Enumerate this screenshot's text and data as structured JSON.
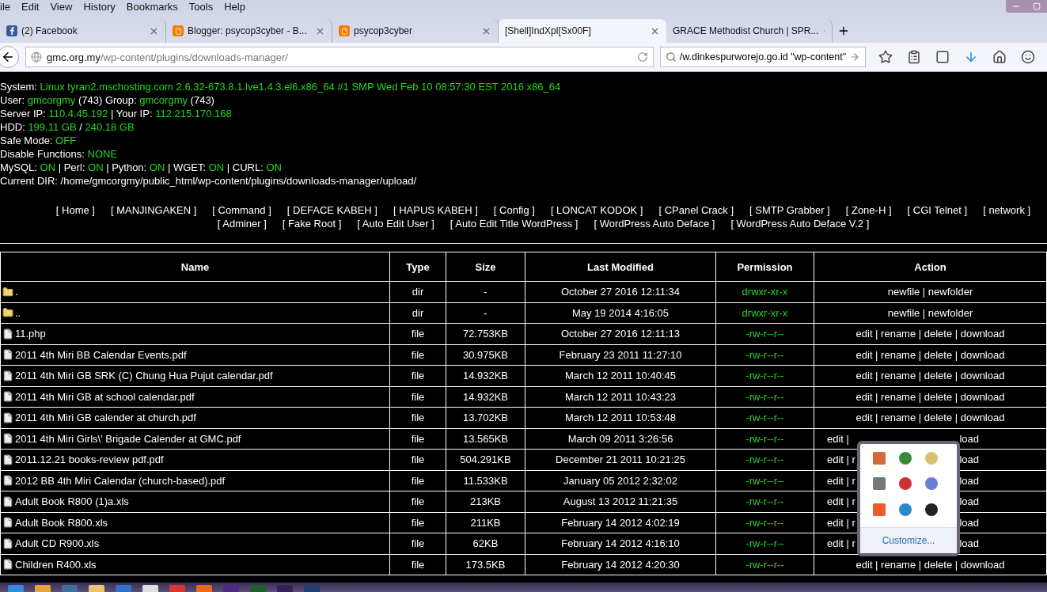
{
  "menu": [
    "ile",
    "Edit",
    "View",
    "History",
    "Bookmarks",
    "Tools",
    "Help"
  ],
  "tabs": [
    {
      "title": "(2) Facebook",
      "selected": false
    },
    {
      "title": "Blogger: psycop3cyber - B...",
      "selected": false
    },
    {
      "title": "psycop3cyber",
      "selected": false
    },
    {
      "title": "[Shell]IndXpl[Sx00F]",
      "selected": true
    },
    {
      "title": "GRACE Methodist Church | SPR...",
      "selected": false
    }
  ],
  "address": {
    "host": "gmc.org.my",
    "path": "/wp-content/plugins/downloads-manager/"
  },
  "search": {
    "value": "/w.dinkespurworejo.go.id \"wp-content\""
  },
  "info": [
    [
      {
        "text": "System: ",
        "kind": "label"
      },
      {
        "text": "Linux tyran2.mschosting.com 2.6.32-673.8.1.lve1.4.3.el6.x86_64 #1 SMP Wed Feb 10 08:57:30 EST 2016 x86_64",
        "kind": "value"
      }
    ],
    [
      {
        "text": "User: ",
        "kind": "label"
      },
      {
        "text": "gmcorgmy",
        "kind": "value"
      },
      {
        "text": " (743) Group: ",
        "kind": "label"
      },
      {
        "text": "gmcorgmy",
        "kind": "value"
      },
      {
        "text": " (743)",
        "kind": "label"
      }
    ],
    [
      {
        "text": "Server IP: ",
        "kind": "label"
      },
      {
        "text": "110.4.45.192",
        "kind": "value"
      },
      {
        "text": " | Your IP: ",
        "kind": "label"
      },
      {
        "text": "112.215.170.168",
        "kind": "value"
      }
    ],
    [
      {
        "text": "HDD: ",
        "kind": "label"
      },
      {
        "text": "199.11 GB",
        "kind": "value"
      },
      {
        "text": " / ",
        "kind": "label"
      },
      {
        "text": "240.18 GB",
        "kind": "value"
      }
    ],
    [
      {
        "text": "Safe Mode: ",
        "kind": "label"
      },
      {
        "text": "OFF",
        "kind": "value"
      }
    ],
    [
      {
        "text": "Disable Functions: ",
        "kind": "label"
      },
      {
        "text": "NONE",
        "kind": "value"
      }
    ],
    [
      {
        "text": "MySQL: ",
        "kind": "label"
      },
      {
        "text": "ON",
        "kind": "value"
      },
      {
        "text": " | Perl: ",
        "kind": "label"
      },
      {
        "text": "ON",
        "kind": "value"
      },
      {
        "text": " | Python: ",
        "kind": "label"
      },
      {
        "text": "ON",
        "kind": "value"
      },
      {
        "text": " | WGET: ",
        "kind": "label"
      },
      {
        "text": "ON",
        "kind": "value"
      },
      {
        "text": " | CURL: ",
        "kind": "label"
      },
      {
        "text": "ON",
        "kind": "value"
      }
    ],
    [
      {
        "text": "Current DIR: /home/gmcorgmy/public_html/wp-content/plugins/downloads-manager/upload/",
        "kind": "label"
      }
    ]
  ],
  "nav_links": [
    "[ Home ]",
    "[ MANJINGAKEN ]",
    "[ Command ]",
    "[ DEFACE KABEH ]",
    "[ HAPUS KABEH ]",
    "[ Config ]",
    "[ LONCAT KODOK ]",
    "[ CPanel Crack ]",
    "[ SMTP Grabber ]",
    "[ Zone-H ]",
    "[ CGI Telnet ]",
    "[ network ]",
    "[ Adminer ]",
    "[ Fake Root ]",
    "[ Auto Edit User ]",
    "[ Auto Edit Title WordPress ]",
    "[ WordPress Auto Deface ]",
    "[ WordPress Auto Deface V.2 ]"
  ],
  "table": {
    "columns": [
      "Name",
      "Type",
      "Size",
      "Last Modified",
      "Permission",
      "Action"
    ],
    "rows": [
      {
        "kind": "dir",
        "name": ".",
        "type": "dir",
        "size": "-",
        "modified": "October 27 2016 12:11:34",
        "permission": "drwxr-xr-x",
        "action": [
          "newfile | newfolder"
        ]
      },
      {
        "kind": "dir",
        "name": "..",
        "type": "dir",
        "size": "-",
        "modified": "May 19 2014 4:16:05",
        "permission": "drwxr-xr-x",
        "action": [
          "newfile | newfolder"
        ]
      },
      {
        "kind": "file",
        "name": "11.php",
        "type": "file",
        "size": "72.753KB",
        "modified": "October 27 2016 12:11:13",
        "permission": "-rw-r--r--",
        "action": [
          "edit | rename | delete | download"
        ]
      },
      {
        "kind": "file",
        "name": "2011 4th Miri BB Calendar Events.pdf",
        "type": "file",
        "size": "30.975KB",
        "modified": "February 23 2011 11:27:10",
        "permission": "-rw-r--r--",
        "action": [
          "edit | rename | delete | download"
        ]
      },
      {
        "kind": "file",
        "name": "2011 4th Miri GB SRK (C) Chung Hua Pujut calendar.pdf",
        "type": "file",
        "size": "14.932KB",
        "modified": "March 12 2011 10:40:45",
        "permission": "-rw-r--r--",
        "action": [
          "edit | rename | delete | download"
        ]
      },
      {
        "kind": "file",
        "name": "2011 4th Miri GB at school calendar.pdf",
        "type": "file",
        "size": "14.932KB",
        "modified": "March 12 2011 10:43:23",
        "permission": "-rw-r--r--",
        "action": [
          "edit | rename | delete | download"
        ]
      },
      {
        "kind": "file",
        "name": "2011 4th Miri GB calender at church.pdf",
        "type": "file",
        "size": "13.702KB",
        "modified": "March 12 2011 10:53:48",
        "permission": "-rw-r--r--",
        "action": [
          "edit | rename | delete | download"
        ]
      },
      {
        "kind": "file",
        "name": "2011 4th Miri Girls\\' Brigade Calender at GMC.pdf",
        "type": "file",
        "size": "13.565KB",
        "modified": "March 09 2011 3:26:56",
        "permission": "-rw-r--r--",
        "action": [
          "edit |",
          "load"
        ]
      },
      {
        "kind": "file",
        "name": "2011.12.21 books-review pdf.pdf",
        "type": "file",
        "size": "504.291KB",
        "modified": "December 21 2011 10:21:25",
        "permission": "-rw-r--r--",
        "action": [
          "edit | r",
          "load"
        ]
      },
      {
        "kind": "file",
        "name": "2012 BB 4th Miri Calendar (church-based).pdf",
        "type": "file",
        "size": "11.533KB",
        "modified": "January 05 2012 2:32:02",
        "permission": "-rw-r--r--",
        "action": [
          "edit | r",
          "load"
        ]
      },
      {
        "kind": "file",
        "name": "Adult Book R800 (1)a.xls",
        "type": "file",
        "size": "213KB",
        "modified": "August 13 2012 11:21:35",
        "permission": "-rw-r--r--",
        "action": [
          "edit | r",
          "load"
        ]
      },
      {
        "kind": "file",
        "name": "Adult Book R800.xls",
        "type": "file",
        "size": "211KB",
        "modified": "February 14 2012 4:02:19",
        "permission": "-rw-r--r--",
        "action": [
          "edit | r",
          "load"
        ]
      },
      {
        "kind": "file",
        "name": "Adult CD R900.xls",
        "type": "file",
        "size": "62KB",
        "modified": "February 14 2012 4:16:10",
        "permission": "-rw-r--r--",
        "action": [
          "edit | r",
          "load"
        ]
      },
      {
        "kind": "file",
        "name": "Children R400.xls",
        "type": "file",
        "size": "173.5KB",
        "modified": "February 14 2012 4:20:30",
        "permission": "-rw-r--r--",
        "action": [
          "edit | rename | delete | download"
        ]
      }
    ]
  },
  "tray_popup": {
    "link": "Customize..."
  }
}
